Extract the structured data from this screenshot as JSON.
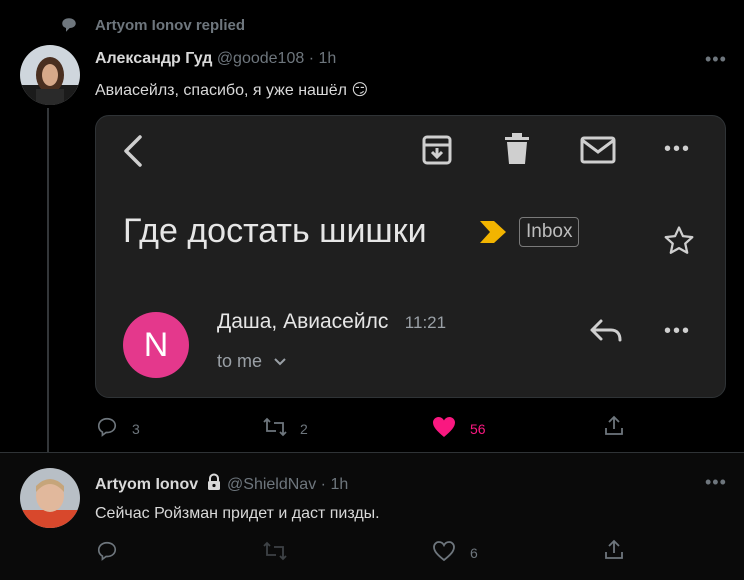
{
  "replied_banner": {
    "text": "Artyom Ionov replied",
    "icon": "comment-icon"
  },
  "tweet1": {
    "author_name": "Александр Гуд",
    "handle": "@goode108",
    "separator": "·",
    "time": "1h",
    "text": "Авиасейлз, спасибо, я уже нашёл",
    "emoji": "😏",
    "more": "•••",
    "actions": {
      "reply_count": "3",
      "retweet_count": "2",
      "like_count": "56"
    },
    "like_color": "#f91880"
  },
  "email_card": {
    "subject": "Где достать шишки",
    "label": "Inbox",
    "sender_initial": "N",
    "sender": "Даша, Авиасейлс",
    "time": "11:21",
    "to": "to me",
    "more": "•••",
    "avatar_color": "#e4388c",
    "importance_color": "#f2b400"
  },
  "tweet2": {
    "author_name": "Artyom Ionov",
    "handle": "@ShieldNav",
    "separator": "·",
    "time": "1h",
    "text": "Сейчас Ройзман придет и даст пизды.",
    "more": "•••",
    "actions": {
      "like_count": "6"
    }
  }
}
